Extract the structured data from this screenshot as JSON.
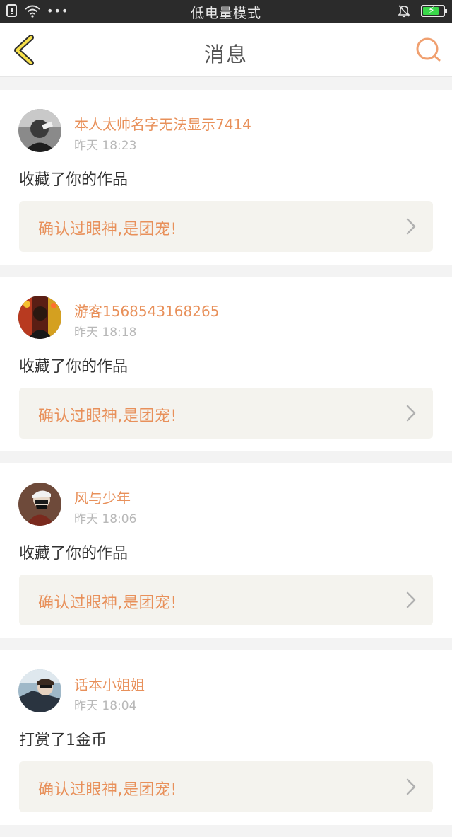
{
  "status_bar": {
    "title": "低电量模式",
    "dots": "•••"
  },
  "nav": {
    "title": "消息",
    "accent_color": "#e8905a",
    "back_icon": "back-chevron-icon",
    "search_icon": "search-icon"
  },
  "messages": [
    {
      "user": "本人太帅名字无法显示7414",
      "time": "昨天 18:23",
      "action": "收藏了你的作品",
      "work_title": "确认过眼神,是团宠!"
    },
    {
      "user": "游客1568543168265",
      "time": "昨天 18:18",
      "action": "收藏了你的作品",
      "work_title": "确认过眼神,是团宠!"
    },
    {
      "user": "风与少年",
      "time": "昨天 18:06",
      "action": "收藏了你的作品",
      "work_title": "确认过眼神,是团宠!"
    },
    {
      "user": "话本小姐姐",
      "time": "昨天 18:04",
      "action": "打赏了1金币",
      "work_title": "确认过眼神,是团宠!"
    }
  ]
}
